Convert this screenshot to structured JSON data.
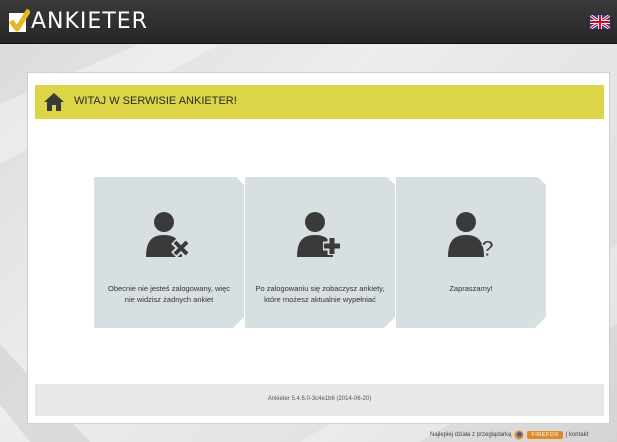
{
  "header": {
    "logo_text": "ANKIETER",
    "language_icon": "uk-flag-icon"
  },
  "welcome": {
    "title": "WITAJ W SERWISIE ANKIETER!",
    "icon": "home-icon",
    "bar_color": "#dcd548"
  },
  "tiles": [
    {
      "icon": "user-x-icon",
      "text": "Obecnie nie jesteś zalogowany, więc nie widzisz żadnych ankiet"
    },
    {
      "icon": "user-plus-icon",
      "text": "Po zalogowaniu się zobaczysz ankiety, które możesz aktualnie wypełniać"
    },
    {
      "icon": "user-question-icon",
      "text": "Zapraszamy!"
    }
  ],
  "footer": {
    "version": "Ankieter 5.4.6.0-3c4e1b6 (2014-06-20)"
  },
  "browser_note": {
    "text": "Najlepiej działa z przeglądarką",
    "badge": "FIREFOX",
    "contact": "| kontakt"
  },
  "colors": {
    "topbar": "#2e2e2e",
    "tile_bg": "#d7dfe3",
    "icon_dark": "#3a3a3a",
    "accent_yellow": "#dcd548"
  }
}
